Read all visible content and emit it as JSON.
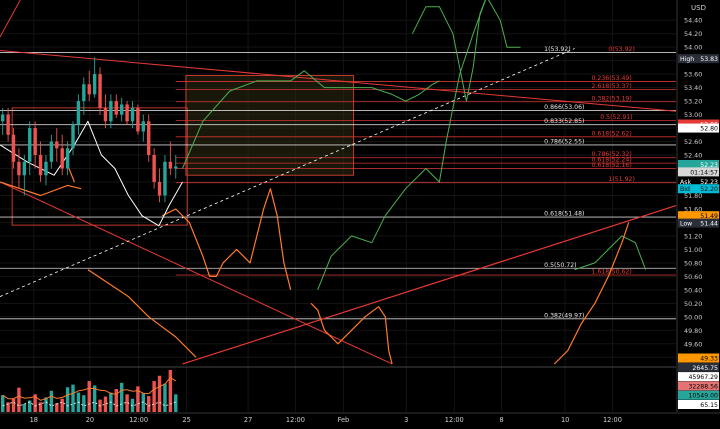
{
  "chart_data": {
    "type": "candlestick",
    "currency_label": "USD",
    "colors": {
      "background": "#000000",
      "bull": "#26a69a",
      "bear": "#ef5350",
      "level_red": "#e53935",
      "level_white": "#e8e8e8",
      "level_orange": "#ff9800",
      "drawing_green": "#4caf50",
      "drawing_orange": "#ff7a2a",
      "drawing_white": "#ffffff",
      "box_fill": "#2b2a10",
      "box_border": "#c0392b"
    },
    "price_axis": {
      "min": 49.27,
      "max": 54.7,
      "ticks": [
        54.4,
        54.2,
        54.0,
        53.8,
        53.6,
        53.4,
        53.2,
        53.0,
        52.8,
        52.6,
        52.4,
        52.2,
        52.0,
        51.8,
        51.6,
        51.4,
        51.2,
        51.0,
        50.8,
        50.6,
        50.4,
        50.2,
        50.0,
        49.8,
        49.6,
        49.4
      ]
    },
    "time_axis": {
      "ticks": [
        {
          "label": "18",
          "pos": 0.05
        },
        {
          "label": "20",
          "pos": 0.133
        },
        {
          "label": "12:00",
          "pos": 0.205
        },
        {
          "label": "25",
          "pos": 0.276
        },
        {
          "label": "27",
          "pos": 0.367
        },
        {
          "label": "12:00",
          "pos": 0.437
        },
        {
          "label": "Feb",
          "pos": 0.508
        },
        {
          "label": "3",
          "pos": 0.601
        },
        {
          "label": "12:00",
          "pos": 0.672
        },
        {
          "label": "8",
          "pos": 0.742
        },
        {
          "label": "10",
          "pos": 0.836
        },
        {
          "label": "12:00",
          "pos": 0.906
        }
      ]
    },
    "price_tags": [
      {
        "label": "High",
        "value": "53.83",
        "price": 53.83,
        "bg": "#2a2e39",
        "fg": "#ffffff"
      },
      {
        "label": "",
        "value": "52.86",
        "price": 52.86,
        "bg": "#e53935",
        "fg": "#ffffff"
      },
      {
        "label": "",
        "value": "52.80",
        "price": 52.8,
        "bg": "#ffffff",
        "fg": "#000000"
      },
      {
        "label": "",
        "value": "52.23",
        "price": 52.26,
        "bg": "#26a69a",
        "fg": "#ffffff"
      },
      {
        "label": "",
        "value": "01:14:57",
        "price": 52.15,
        "bg": "#d8d8d8",
        "fg": "#000000"
      },
      {
        "label": "Ask",
        "value": "52.23",
        "price": 52.01,
        "bg": "#000000",
        "fg": "#ffffff"
      },
      {
        "label": "Bid",
        "value": "52.20",
        "price": 51.9,
        "bg": "#00bcd4",
        "fg": "#000000"
      },
      {
        "label": "",
        "value": "51.49",
        "price": 51.5,
        "bg": "#ff9800",
        "fg": "#000000"
      },
      {
        "label": "Low",
        "value": "51.44",
        "price": 51.39,
        "bg": "#2a2e39",
        "fg": "#ffffff"
      }
    ],
    "levels": [
      {
        "label": "1(53.92)",
        "price": 53.92,
        "color": "#e8e8e8",
        "label_pos": 0.805,
        "x0": 0.0
      },
      {
        "label": "0(53.92)",
        "price": 53.92,
        "color": "#e53935",
        "label_pos": 0.9,
        "x0": -1
      },
      {
        "label": "0.236(53.49)",
        "price": 53.49,
        "color": "#e53935",
        "label_pos": 0.875,
        "x0": 0.26
      },
      {
        "label": "2.618(53.37)",
        "price": 53.37,
        "color": "#e53935",
        "label_pos": 0.875,
        "x0": 0.26
      },
      {
        "label": "0.382(53.19)",
        "price": 53.19,
        "color": "#e53935",
        "label_pos": 0.875,
        "x0": 0.26
      },
      {
        "label": "0.866(53.06)",
        "price": 53.06,
        "color": "#e8e8e8",
        "label_pos": 0.805,
        "x0": 0.0
      },
      {
        "label": "0.5(52.91)",
        "price": 52.91,
        "color": "#e53935",
        "label_pos": 0.888,
        "x0": 0.26
      },
      {
        "label": "0.833(52.85)",
        "price": 52.85,
        "color": "#e8e8e8",
        "label_pos": 0.805,
        "x0": 0.0
      },
      {
        "label": "0.618(52.62)",
        "price": 52.67,
        "color": "#e53935",
        "label_pos": 0.875,
        "x0": 0.26
      },
      {
        "label": "0.786(52.55)",
        "price": 52.55,
        "color": "#e8e8e8",
        "label_pos": 0.805,
        "x0": 0.0
      },
      {
        "label": "0.786(52.32)",
        "price": 52.36,
        "color": "#e53935",
        "label_pos": 0.875,
        "x0": 0.26
      },
      {
        "label": "0.618(52.24)",
        "price": 52.28,
        "color": "#e53935",
        "label_pos": 0.875,
        "x0": 0.26
      },
      {
        "label": "0.618(52.16)",
        "price": 52.2,
        "color": "#e53935",
        "label_pos": 0.875,
        "x0": 0.26
      },
      {
        "label": "1(51.92)",
        "price": 51.99,
        "color": "#e53935",
        "label_pos": 0.9,
        "x0": 0.26
      },
      {
        "label": "0.618(51.48)",
        "price": 51.48,
        "color": "#e8e8e8",
        "label_pos": 0.805,
        "x0": 0.0
      },
      {
        "label": "0.5(50.72)",
        "price": 50.72,
        "color": "#e8e8e8",
        "label_pos": 0.805,
        "x0": 0.0
      },
      {
        "label": "1.618(50.62)",
        "price": 50.62,
        "color": "#e53935",
        "label_pos": 0.875,
        "x0": 0.26
      },
      {
        "label": "0.382(49.97)",
        "price": 49.97,
        "color": "#e8e8e8",
        "label_pos": 0.805,
        "x0": 0.0
      }
    ],
    "candles": [
      {
        "t": 0.004,
        "o": 52.9,
        "h": 53.1,
        "l": 52.7,
        "c": 53.0
      },
      {
        "t": 0.012,
        "o": 53.0,
        "h": 53.1,
        "l": 52.6,
        "c": 52.7
      },
      {
        "t": 0.02,
        "o": 52.7,
        "h": 52.8,
        "l": 52.2,
        "c": 52.3
      },
      {
        "t": 0.028,
        "o": 52.3,
        "h": 52.5,
        "l": 51.9,
        "c": 52.1
      },
      {
        "t": 0.036,
        "o": 52.1,
        "h": 52.4,
        "l": 51.8,
        "c": 52.3
      },
      {
        "t": 0.044,
        "o": 52.3,
        "h": 52.9,
        "l": 52.1,
        "c": 52.8
      },
      {
        "t": 0.052,
        "o": 52.8,
        "h": 52.9,
        "l": 52.2,
        "c": 52.4
      },
      {
        "t": 0.06,
        "o": 52.4,
        "h": 52.6,
        "l": 52.0,
        "c": 52.1
      },
      {
        "t": 0.068,
        "o": 52.1,
        "h": 52.4,
        "l": 51.95,
        "c": 52.3
      },
      {
        "t": 0.076,
        "o": 52.3,
        "h": 52.7,
        "l": 52.2,
        "c": 52.6
      },
      {
        "t": 0.084,
        "o": 52.6,
        "h": 52.8,
        "l": 52.3,
        "c": 52.5
      },
      {
        "t": 0.092,
        "o": 52.5,
        "h": 52.7,
        "l": 52.1,
        "c": 52.2
      },
      {
        "t": 0.1,
        "o": 52.2,
        "h": 52.6,
        "l": 52.1,
        "c": 52.5
      },
      {
        "t": 0.108,
        "o": 52.5,
        "h": 52.9,
        "l": 52.4,
        "c": 52.85
      },
      {
        "t": 0.116,
        "o": 52.85,
        "h": 53.3,
        "l": 52.7,
        "c": 53.2
      },
      {
        "t": 0.124,
        "o": 53.2,
        "h": 53.55,
        "l": 53.0,
        "c": 53.45
      },
      {
        "t": 0.132,
        "o": 53.45,
        "h": 53.65,
        "l": 53.2,
        "c": 53.3
      },
      {
        "t": 0.14,
        "o": 53.3,
        "h": 53.85,
        "l": 53.25,
        "c": 53.6
      },
      {
        "t": 0.148,
        "o": 53.6,
        "h": 53.7,
        "l": 53.0,
        "c": 53.1
      },
      {
        "t": 0.156,
        "o": 53.1,
        "h": 53.3,
        "l": 52.8,
        "c": 52.9
      },
      {
        "t": 0.164,
        "o": 52.9,
        "h": 53.3,
        "l": 52.8,
        "c": 53.2
      },
      {
        "t": 0.172,
        "o": 53.2,
        "h": 53.3,
        "l": 52.95,
        "c": 53.0
      },
      {
        "t": 0.18,
        "o": 53.0,
        "h": 53.25,
        "l": 52.9,
        "c": 53.15
      },
      {
        "t": 0.188,
        "o": 53.15,
        "h": 53.2,
        "l": 52.85,
        "c": 52.9
      },
      {
        "t": 0.196,
        "o": 52.9,
        "h": 53.2,
        "l": 52.8,
        "c": 53.1
      },
      {
        "t": 0.204,
        "o": 53.1,
        "h": 53.15,
        "l": 52.7,
        "c": 52.75
      },
      {
        "t": 0.212,
        "o": 52.75,
        "h": 53.0,
        "l": 52.6,
        "c": 52.9
      },
      {
        "t": 0.22,
        "o": 52.9,
        "h": 53.0,
        "l": 52.3,
        "c": 52.4
      },
      {
        "t": 0.228,
        "o": 52.4,
        "h": 52.5,
        "l": 51.9,
        "c": 52.0
      },
      {
        "t": 0.236,
        "o": 52.0,
        "h": 52.2,
        "l": 51.7,
        "c": 51.8
      },
      {
        "t": 0.244,
        "o": 51.8,
        "h": 52.4,
        "l": 51.7,
        "c": 52.3
      },
      {
        "t": 0.252,
        "o": 52.3,
        "h": 52.6,
        "l": 52.1,
        "c": 52.2
      },
      {
        "t": 0.26,
        "o": 52.2,
        "h": 52.4,
        "l": 52.05,
        "c": 52.23
      }
    ],
    "volume": [
      38,
      22,
      30,
      55,
      18,
      26,
      40,
      22,
      33,
      48,
      20,
      30,
      56,
      62,
      44,
      38,
      70,
      60,
      28,
      35,
      44,
      52,
      66,
      40,
      30,
      58,
      42,
      36,
      70,
      82,
      64,
      95,
      40
    ],
    "indicator_tags": [
      {
        "value": "49.33",
        "bg": "#ff9800",
        "fg": "#000000"
      },
      {
        "value": "2645.75",
        "bg": "#2a2e39",
        "fg": "#ffffff"
      },
      {
        "value": "45967.29",
        "bg": "#ffffff",
        "fg": "#000000"
      },
      {
        "value": "32288.56",
        "bg": "#e57373",
        "fg": "#000000"
      },
      {
        "value": "10549.00",
        "bg": "#26a69a",
        "fg": "#000000"
      },
      {
        "value": "65.15",
        "bg": "#ffffff",
        "fg": "#000000"
      }
    ]
  }
}
